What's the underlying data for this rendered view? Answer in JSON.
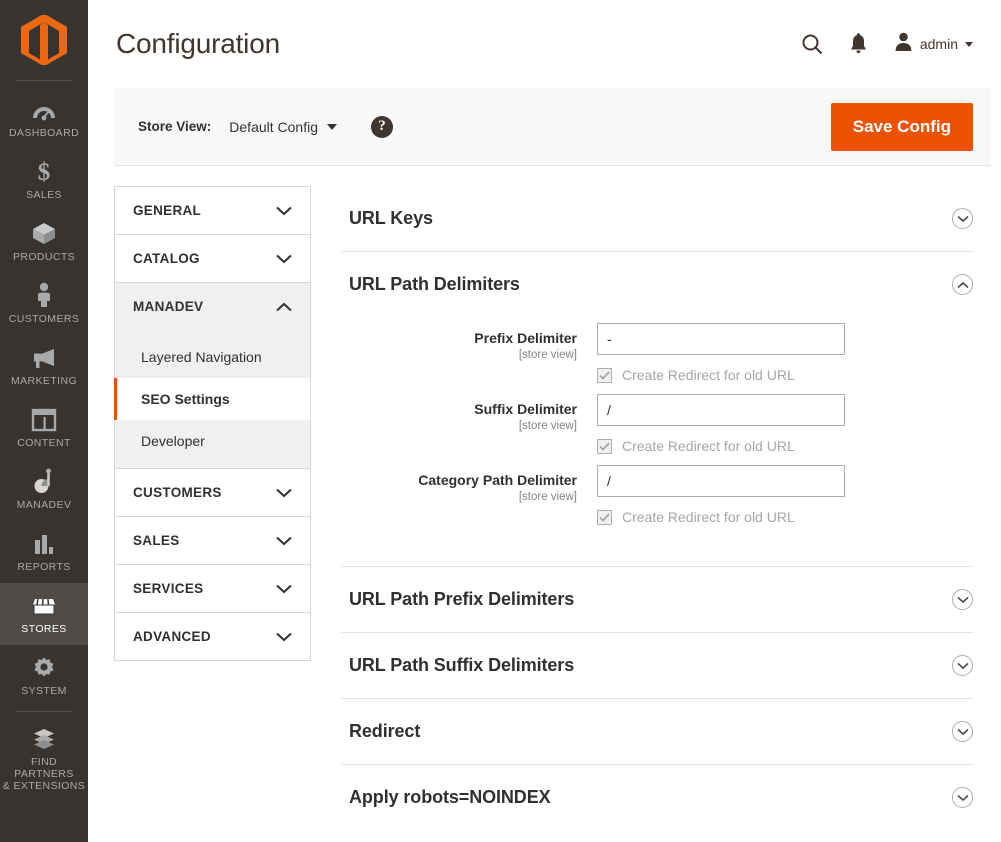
{
  "global_nav": {
    "logo": "magento-logo",
    "items": [
      {
        "label": "DASHBOARD",
        "icon": "dashboard-icon",
        "active": false
      },
      {
        "label": "SALES",
        "icon": "dollar-icon",
        "active": false
      },
      {
        "label": "PRODUCTS",
        "icon": "box-icon",
        "active": false
      },
      {
        "label": "CUSTOMERS",
        "icon": "person-icon",
        "active": false
      },
      {
        "label": "MARKETING",
        "icon": "megaphone-icon",
        "active": false
      },
      {
        "label": "CONTENT",
        "icon": "layout-icon",
        "active": false
      },
      {
        "label": "MANADEV",
        "icon": "manadev-icon",
        "active": false
      },
      {
        "label": "REPORTS",
        "icon": "bar-chart-icon",
        "active": false
      },
      {
        "label": "STORES",
        "icon": "store-icon",
        "active": true
      },
      {
        "label": "SYSTEM",
        "icon": "gear-icon",
        "active": false
      },
      {
        "label": "FIND PARTNERS\n& EXTENSIONS",
        "icon": "extensions-icon",
        "active": false
      }
    ],
    "find_partners_line1": "FIND PARTNERS",
    "find_partners_line2": "& EXTENSIONS"
  },
  "header": {
    "title": "Configuration",
    "search_icon": "search-icon",
    "notifications_icon": "bell-icon",
    "user_icon": "user-avatar-icon",
    "user_name": "admin"
  },
  "store_bar": {
    "store_view_label": "Store View:",
    "store_view_value": "Default Config",
    "help_label": "?",
    "save_label": "Save Config",
    "accent_color": "#eb5202"
  },
  "config_nav": {
    "sections": [
      {
        "label": "GENERAL",
        "open": false,
        "children": []
      },
      {
        "label": "CATALOG",
        "open": false,
        "children": []
      },
      {
        "label": "MANADEV",
        "open": true,
        "children": [
          {
            "label": "Layered Navigation",
            "current": false
          },
          {
            "label": "SEO Settings",
            "current": true
          },
          {
            "label": "Developer",
            "current": false
          }
        ]
      },
      {
        "label": "CUSTOMERS",
        "open": false,
        "children": []
      },
      {
        "label": "SALES",
        "open": false,
        "children": []
      },
      {
        "label": "SERVICES",
        "open": false,
        "children": []
      },
      {
        "label": "ADVANCED",
        "open": false,
        "children": []
      }
    ]
  },
  "main": {
    "sections": [
      {
        "title": "URL Keys",
        "expanded": false,
        "fields": []
      },
      {
        "title": "URL Path Delimiters",
        "expanded": true,
        "fields": [
          {
            "label": "Prefix Delimiter",
            "scope": "[store view]",
            "value": "-",
            "checkbox_label": "Create Redirect for old URL",
            "checked": true,
            "disabled": true
          },
          {
            "label": "Suffix Delimiter",
            "scope": "[store view]",
            "value": "/",
            "checkbox_label": "Create Redirect for old URL",
            "checked": true,
            "disabled": true
          },
          {
            "label": "Category Path Delimiter",
            "scope": "[store view]",
            "value": "/",
            "checkbox_label": "Create Redirect for old URL",
            "checked": true,
            "disabled": true
          }
        ]
      },
      {
        "title": "URL Path Prefix Delimiters",
        "expanded": false,
        "fields": []
      },
      {
        "title": "URL Path Suffix Delimiters",
        "expanded": false,
        "fields": []
      },
      {
        "title": "Redirect",
        "expanded": false,
        "fields": []
      },
      {
        "title": "Apply robots=NOINDEX",
        "expanded": false,
        "fields": []
      }
    ]
  }
}
